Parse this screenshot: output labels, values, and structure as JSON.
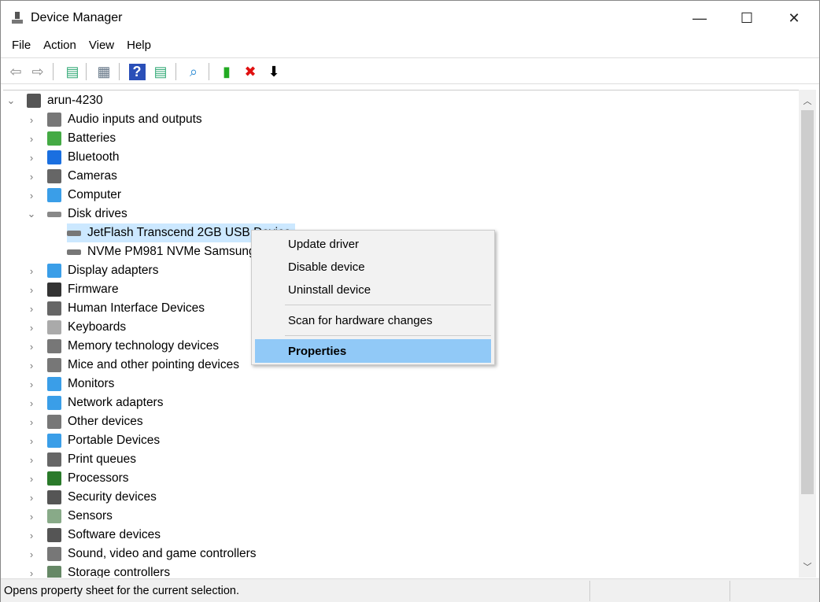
{
  "window": {
    "title": "Device Manager",
    "minimize": "—",
    "maximize": "☐",
    "close": "✕"
  },
  "menubar": [
    "File",
    "Action",
    "View",
    "Help"
  ],
  "toolbar": [
    {
      "icon": "back-arrow-icon",
      "glyph": "⇦",
      "color": "#888"
    },
    {
      "icon": "forward-arrow-icon",
      "glyph": "⇨",
      "color": "#888"
    },
    {
      "icon": "show-hide-console-tree-icon",
      "glyph": "▤",
      "color": "#3a7"
    },
    {
      "icon": "properties-icon",
      "glyph": "▦",
      "color": "#678"
    },
    {
      "icon": "help-icon",
      "glyph": "?",
      "color": "#fff",
      "bg": "#2a4fb8"
    },
    {
      "icon": "show-action-pane-icon",
      "glyph": "▤",
      "color": "#3a7"
    },
    {
      "icon": "scan-hardware-icon",
      "glyph": "⌕",
      "color": "#2a8ad4"
    },
    {
      "icon": "update-driver-icon",
      "glyph": "▮",
      "color": "#2a2"
    },
    {
      "icon": "uninstall-icon",
      "glyph": "✖",
      "color": "#e01010"
    },
    {
      "icon": "disable-device-icon",
      "glyph": "⬇",
      "color": "#000"
    }
  ],
  "tree": {
    "root": "arun-4230",
    "categories": [
      {
        "label": "Audio inputs and outputs",
        "icon": "speaker-icon",
        "color": "#777"
      },
      {
        "label": "Batteries",
        "icon": "battery-icon",
        "color": "#4a4"
      },
      {
        "label": "Bluetooth",
        "icon": "bluetooth-icon",
        "color": "#1a6fe0"
      },
      {
        "label": "Cameras",
        "icon": "camera-icon",
        "color": "#666"
      },
      {
        "label": "Computer",
        "icon": "computer-icon",
        "color": "#3a9ee8"
      },
      {
        "label": "Disk drives",
        "icon": "disk-drive-icon",
        "color": "#888",
        "expanded": true,
        "children": [
          {
            "label": "JetFlash Transcend 2GB USB Device",
            "selected": true
          },
          {
            "label": "NVMe PM981 NVMe Samsung"
          }
        ]
      },
      {
        "label": "Display adapters",
        "icon": "display-adapter-icon",
        "color": "#3a9ee8"
      },
      {
        "label": "Firmware",
        "icon": "firmware-icon",
        "color": "#333"
      },
      {
        "label": "Human Interface Devices",
        "icon": "hid-icon",
        "color": "#666"
      },
      {
        "label": "Keyboards",
        "icon": "keyboard-icon",
        "color": "#aaa"
      },
      {
        "label": "Memory technology devices",
        "icon": "memory-icon",
        "color": "#777"
      },
      {
        "label": "Mice and other pointing devices",
        "icon": "mouse-icon",
        "color": "#777"
      },
      {
        "label": "Monitors",
        "icon": "monitor-icon",
        "color": "#3a9ee8"
      },
      {
        "label": "Network adapters",
        "icon": "network-icon",
        "color": "#3a9ee8"
      },
      {
        "label": "Other devices",
        "icon": "other-devices-icon",
        "color": "#777"
      },
      {
        "label": "Portable Devices",
        "icon": "portable-device-icon",
        "color": "#3a9ee8"
      },
      {
        "label": "Print queues",
        "icon": "printer-icon",
        "color": "#666"
      },
      {
        "label": "Processors",
        "icon": "processor-icon",
        "color": "#2a7a2a"
      },
      {
        "label": "Security devices",
        "icon": "security-icon",
        "color": "#555"
      },
      {
        "label": "Sensors",
        "icon": "sensor-icon",
        "color": "#8a8"
      },
      {
        "label": "Software devices",
        "icon": "software-device-icon",
        "color": "#555"
      },
      {
        "label": "Sound, video and game controllers",
        "icon": "speaker-icon",
        "color": "#777"
      },
      {
        "label": "Storage controllers",
        "icon": "storage-controller-icon",
        "color": "#686"
      }
    ]
  },
  "context_menu": {
    "items": [
      "Update driver",
      "Disable device",
      "Uninstall device",
      "Scan for hardware changes",
      "Properties"
    ],
    "highlighted": "Properties"
  },
  "status": {
    "text": "Opens property sheet for the current selection."
  },
  "colors": {
    "selection": "#cce8ff",
    "menu_highlight": "#91c9f7"
  }
}
